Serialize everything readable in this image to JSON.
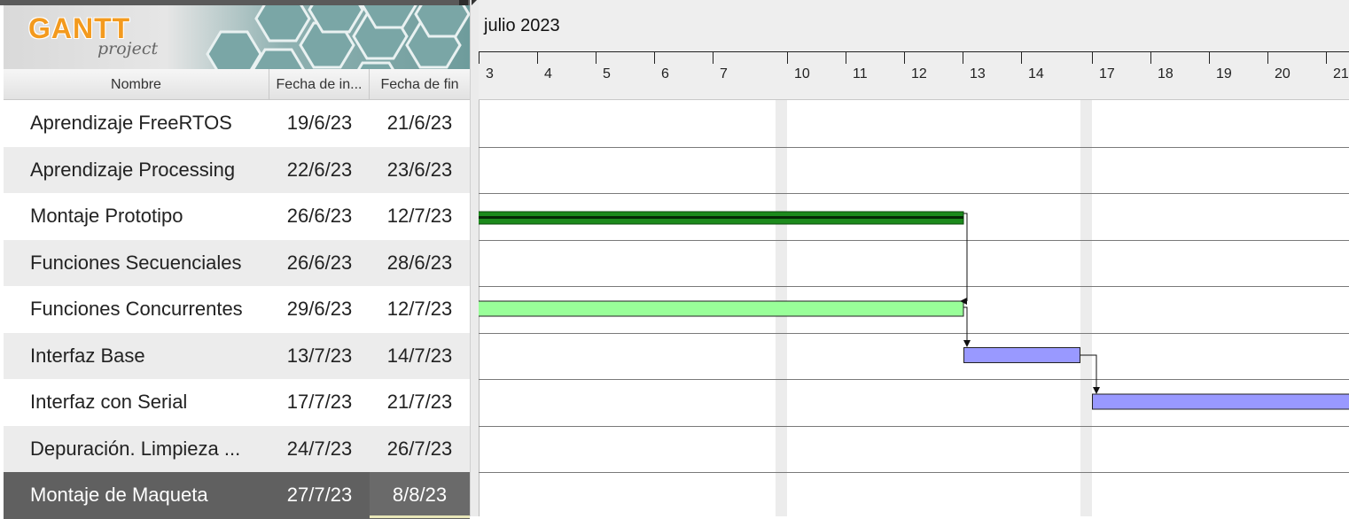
{
  "app": {
    "logo_text": "GANTT",
    "logo_subtext": "project"
  },
  "table": {
    "columns": [
      "Nombre",
      "Fecha de in...",
      "Fecha de fin"
    ],
    "rows": [
      {
        "name": "Aprendizaje FreeRTOS",
        "start": "19/6/23",
        "end": "21/6/23"
      },
      {
        "name": "Aprendizaje Processing",
        "start": "22/6/23",
        "end": "23/6/23"
      },
      {
        "name": "Montaje Prototipo",
        "start": "26/6/23",
        "end": "12/7/23"
      },
      {
        "name": "Funciones Secuenciales",
        "start": "26/6/23",
        "end": "28/6/23"
      },
      {
        "name": "Funciones Concurrentes",
        "start": "29/6/23",
        "end": "12/7/23"
      },
      {
        "name": "Interfaz Base",
        "start": "13/7/23",
        "end": "14/7/23"
      },
      {
        "name": "Interfaz con Serial",
        "start": "17/7/23",
        "end": "21/7/23"
      },
      {
        "name": "Depuración. Limpieza ...",
        "start": "24/7/23",
        "end": "26/7/23"
      },
      {
        "name": "Montaje de Maqueta",
        "start": "27/7/23",
        "end": "8/8/23"
      }
    ],
    "selected_row": 8
  },
  "timeline": {
    "month": "julio 2023",
    "days": [
      "3",
      "4",
      "5",
      "6",
      "7",
      "10",
      "11",
      "12",
      "13",
      "14",
      "17",
      "18",
      "19",
      "20",
      "21"
    ],
    "weekend_columns_after": [
      "7",
      "14"
    ]
  },
  "colors": {
    "summary_bar": "#1c8a1c",
    "task_green": "#99ff99",
    "task_blue": "#9999ff",
    "row_selected": "#606060",
    "weekend": "#ececec"
  }
}
